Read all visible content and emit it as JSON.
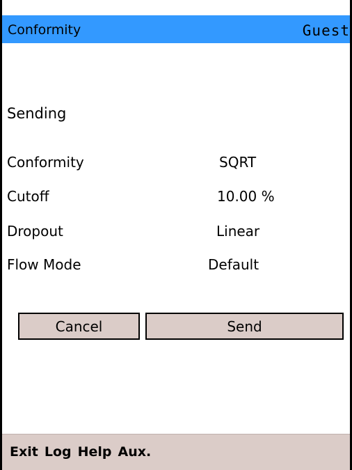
{
  "header": {
    "title": "Conformity",
    "user": "Guest"
  },
  "status": "Sending",
  "settings": [
    {
      "label": "Conformity",
      "value": "SQRT"
    },
    {
      "label": "Cutoff",
      "value": "10.00 %"
    },
    {
      "label": "Dropout",
      "value": "Linear"
    },
    {
      "label": "Flow Mode",
      "value": "Default"
    }
  ],
  "buttons": {
    "cancel": "Cancel",
    "send": "Send"
  },
  "menu": {
    "exit": "Exit",
    "log": "Log",
    "help": "Help",
    "aux": "Aux."
  },
  "colors": {
    "titlebar": "#3399ff",
    "button_bg": "#dbccc8",
    "footer_bg": "#dbccc8"
  }
}
